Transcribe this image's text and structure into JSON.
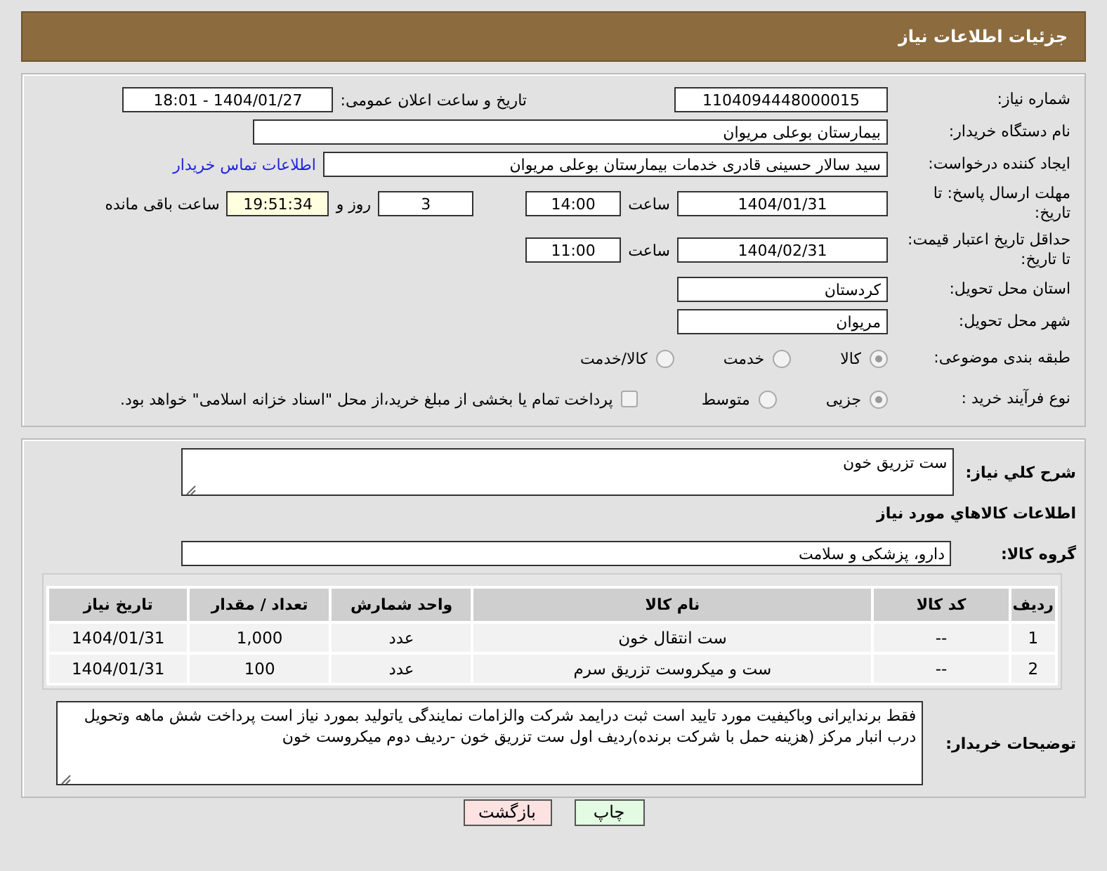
{
  "header": {
    "title": "جزئیات اطلاعات نیاز"
  },
  "details": {
    "need_number": {
      "label": "شماره نیاز:",
      "value": "1104094448000015"
    },
    "announce": {
      "label": "تاریخ و ساعت اعلان عمومی:",
      "value": "1404/01/27 - 18:01"
    },
    "buyer": {
      "label": "نام دستگاه خریدار:",
      "value": "بیمارستان بوعلی مریوان"
    },
    "creator": {
      "label": "ایجاد کننده درخواست:",
      "value": "سید سالار حسینی قادری خدمات بیمارستان بوعلی مریوان",
      "link": "اطلاعات تماس خریدار"
    },
    "deadline": {
      "label": "مهلت ارسال پاسخ: تا تاریخ:",
      "date": "1404/01/31",
      "time_label": "ساعت",
      "time": "14:00",
      "days": "3",
      "days_label": "روز و",
      "remaining": "19:51:34",
      "remaining_label": "ساعت باقی مانده"
    },
    "validity": {
      "label": "حداقل تاریخ اعتبار قیمت: تا تاریخ:",
      "date": "1404/02/31",
      "time_label": "ساعت",
      "time": "11:00"
    },
    "province": {
      "label": "استان محل تحویل:",
      "value": "کردستان"
    },
    "city": {
      "label": "شهر محل تحویل:",
      "value": "مریوان"
    },
    "category": {
      "label": "طبقه بندی موضوعی:",
      "options": [
        {
          "label": "کالا",
          "selected": true
        },
        {
          "label": "خدمت",
          "selected": false
        },
        {
          "label": "کالا/خدمت",
          "selected": false
        }
      ]
    },
    "process": {
      "label": "نوع فرآیند خرید :",
      "options": [
        {
          "label": "جزیی",
          "selected": true
        },
        {
          "label": "متوسط",
          "selected": false
        }
      ],
      "payment": {
        "label": "پرداخت تمام یا بخشی از مبلغ خرید،از محل \"اسناد خزانه اسلامی\" خواهد بود.",
        "checked": false
      }
    }
  },
  "items": {
    "summary": {
      "label": "شرح کلي نياز:",
      "value": "ست تزریق خون"
    },
    "heading": "اطلاعات كالاهاي مورد نياز",
    "group": {
      "label": "گروه کالا:",
      "value": "دارو، پزشکی و سلامت"
    },
    "table": {
      "columns": [
        "ردیف",
        "کد کالا",
        "نام کالا",
        "واحد شمارش",
        "تعداد / مقدار",
        "تاریخ نیاز"
      ],
      "rows": [
        [
          "1",
          "--",
          "ست انتقال خون",
          "عدد",
          "1,000",
          "1404/01/31"
        ],
        [
          "2",
          "--",
          "ست و میکروست تزریق سرم",
          "عدد",
          "100",
          "1404/01/31"
        ]
      ]
    },
    "buyer_notes": {
      "label": "توضیحات خریدار:",
      "value": "فقط برندایرانی وباکیفیت مورد تایید است ثبت درایمد شرکت والزامات نمایندگی یاتولید بمورد نیاز است پرداخت شش ماهه وتحویل درب انبار مرکز (هزینه حمل با شرکت برنده)ردیف اول ست تزریق خون -ردیف دوم میکروست خون"
    }
  },
  "buttons": [
    {
      "label": "چاپ",
      "kind": "print"
    },
    {
      "label": "بازگشت",
      "kind": "back"
    }
  ]
}
